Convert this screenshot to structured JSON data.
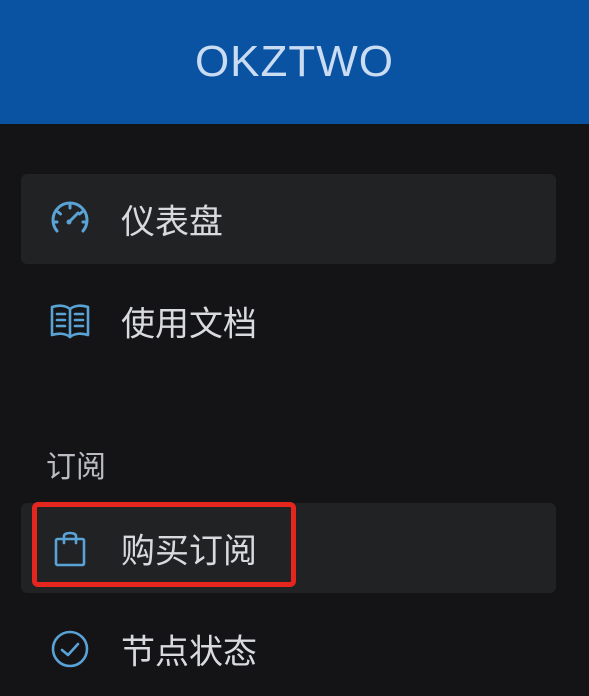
{
  "header": {
    "brand": "OKZTWO",
    "colors": {
      "background": "#0a52a2",
      "text": "#c9dcf2"
    }
  },
  "sidebar": {
    "items": [
      {
        "label": "仪表盘",
        "icon": "dashboard-speedometer-icon",
        "active": true
      },
      {
        "label": "使用文档",
        "icon": "book-icon"
      }
    ],
    "sections": [
      {
        "header": "订阅",
        "items": [
          {
            "label": "购买订阅",
            "icon": "shopping-bag-icon",
            "highlighted": true
          },
          {
            "label": "节点状态",
            "icon": "check-circle-icon"
          }
        ]
      }
    ],
    "colors": {
      "background": "#141416",
      "item_active": "#212224",
      "icon": "#5aa3d6",
      "text": "#d8dadd",
      "highlight_border": "#e5261e"
    }
  }
}
